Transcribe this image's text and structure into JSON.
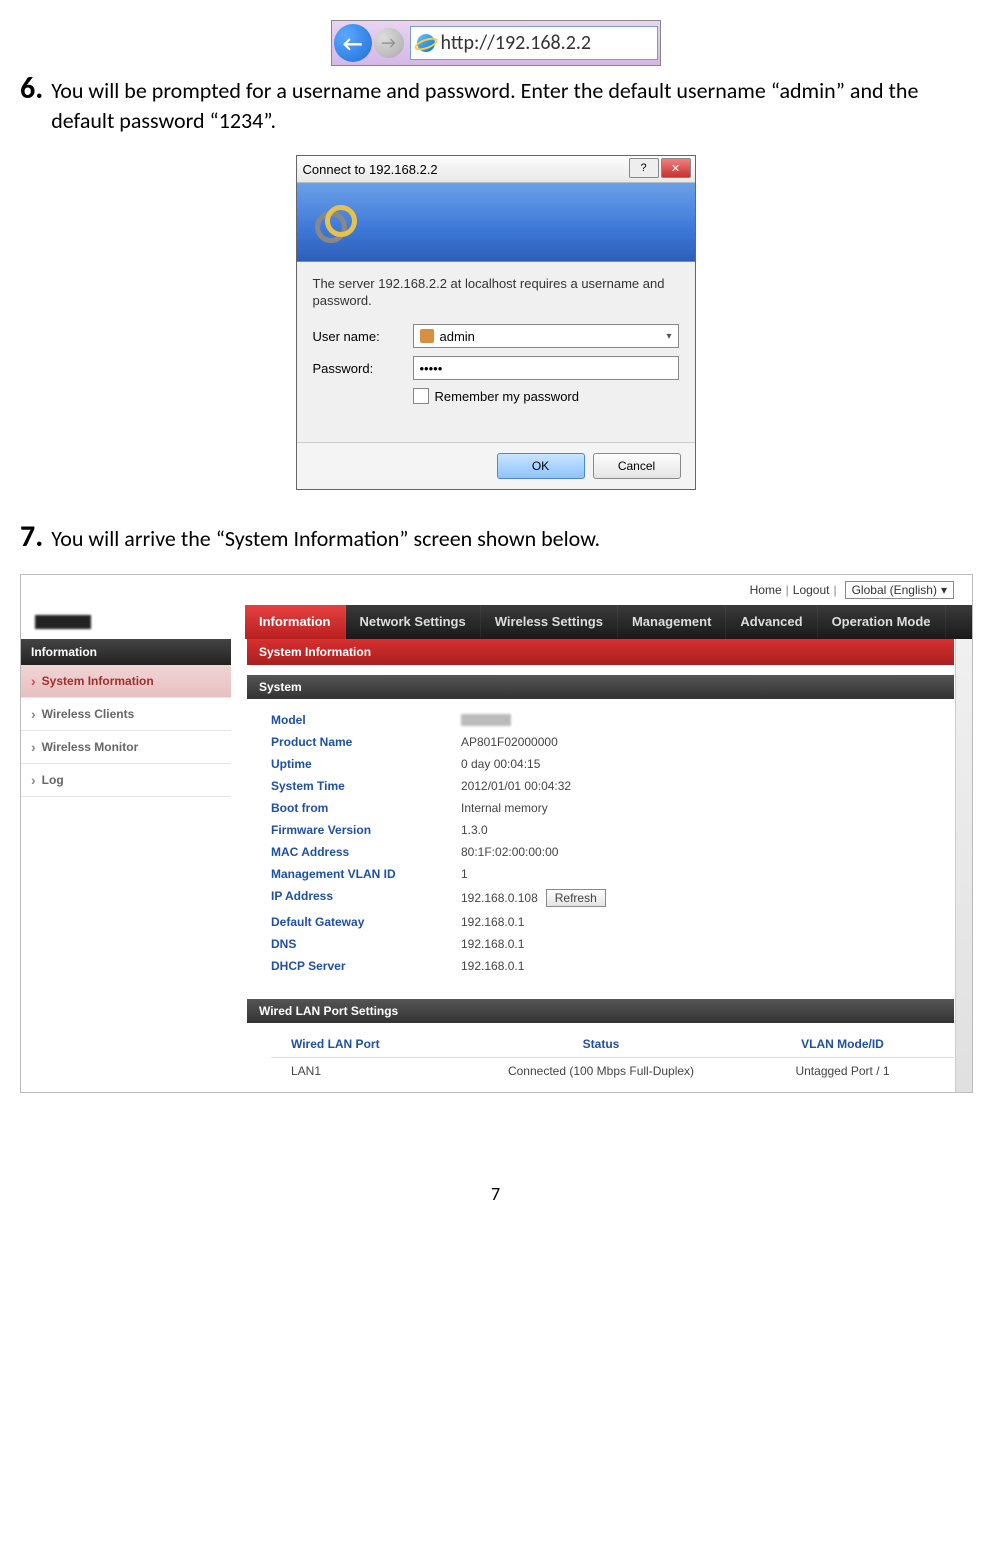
{
  "page_number": "7",
  "browser": {
    "url": "http://192.168.2.2"
  },
  "steps": {
    "s6_num": "6.",
    "s6_text": "You will be prompted for a username and password. Enter the default username “admin” and the default password “1234”.",
    "s7_num": "7.",
    "s7_text": "You will arrive the “System Information” screen shown below."
  },
  "dialog": {
    "title": "Connect to 192.168.2.2",
    "prompt": "The server 192.168.2.2 at localhost requires a username and password.",
    "user_label": "User name:",
    "user_value": "admin",
    "pass_label": "Password:",
    "pass_value": "•••••",
    "remember": "Remember my password",
    "ok": "OK",
    "cancel": "Cancel"
  },
  "admin": {
    "top": {
      "home": "Home",
      "logout": "Logout",
      "lang": "Global (English)"
    },
    "nav": [
      "Information",
      "Network Settings",
      "Wireless Settings",
      "Management",
      "Advanced",
      "Operation Mode"
    ],
    "side_head": "Information",
    "side": [
      "System Information",
      "Wireless Clients",
      "Wireless Monitor",
      "Log"
    ],
    "panel_title": "System Information",
    "sub_system": "System",
    "rows": [
      {
        "k": "Model",
        "v": ""
      },
      {
        "k": "Product Name",
        "v": "AP801F02000000"
      },
      {
        "k": "Uptime",
        "v": "0 day 00:04:15"
      },
      {
        "k": "System Time",
        "v": "2012/01/01 00:04:32"
      },
      {
        "k": "Boot from",
        "v": "Internal memory"
      },
      {
        "k": "Firmware Version",
        "v": "1.3.0"
      },
      {
        "k": "MAC Address",
        "v": "80:1F:02:00:00:00"
      },
      {
        "k": "Management VLAN ID",
        "v": "1"
      },
      {
        "k": "IP Address",
        "v": "192.168.0.108",
        "refresh": true
      },
      {
        "k": "Default Gateway",
        "v": "192.168.0.1"
      },
      {
        "k": "DNS",
        "v": "192.168.0.1"
      },
      {
        "k": "DHCP Server",
        "v": "192.168.0.1"
      }
    ],
    "refresh_label": "Refresh",
    "sub_lan": "Wired LAN Port Settings",
    "lan_head": {
      "c1": "Wired LAN Port",
      "c2": "Status",
      "c3": "VLAN Mode/ID"
    },
    "lan_row": {
      "c1": "LAN1",
      "c2": "Connected (100 Mbps Full-Duplex)",
      "c3": "Untagged Port / 1"
    }
  }
}
